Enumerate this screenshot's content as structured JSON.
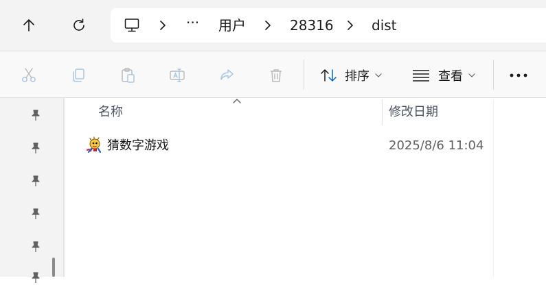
{
  "address_bar": {
    "breadcrumbs": [
      "用户",
      "28316",
      "dist"
    ],
    "overflow": "···"
  },
  "toolbar": {
    "sort_label": "排序",
    "view_label": "查看"
  },
  "columns": {
    "name": "名称",
    "date_modified": "修改日期"
  },
  "files": [
    {
      "name": "猜数字游戏",
      "date_modified": "2025/8/6 11:04",
      "icon": "game-app-icon"
    }
  ],
  "colors": {
    "accent": "#0067c0",
    "disabled_icon": "#a8c7e6",
    "nav_background": "#f3f3f3"
  }
}
